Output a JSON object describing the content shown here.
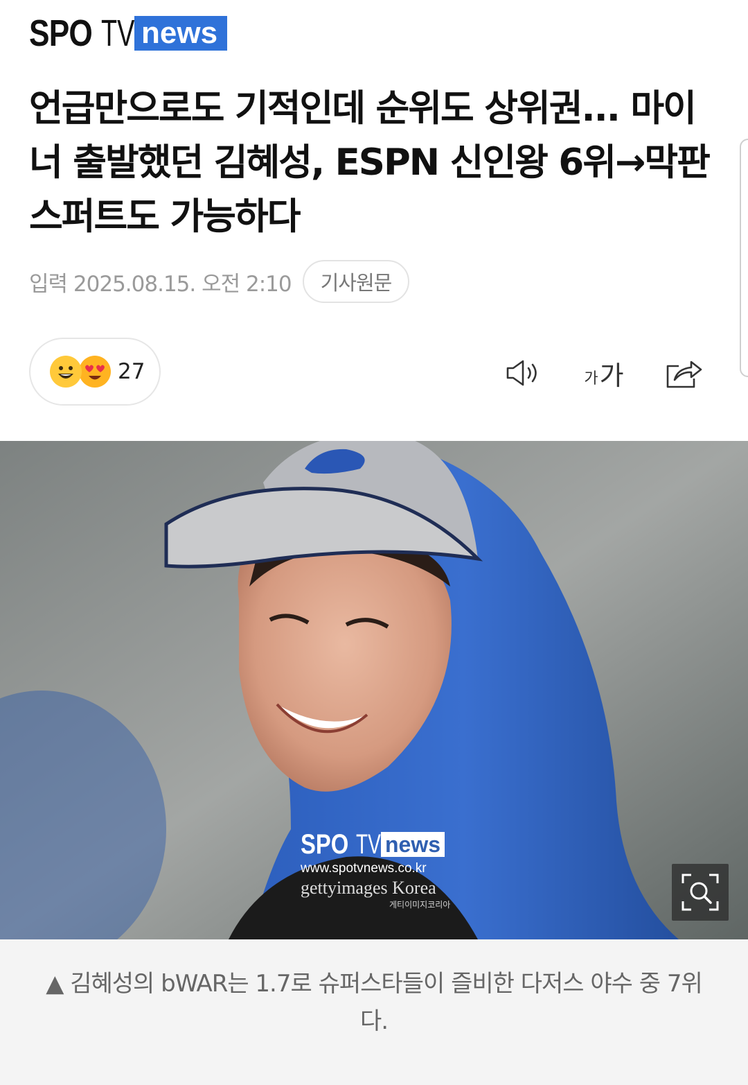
{
  "header": {
    "logo_spo": "SPO",
    "logo_tv": "TV",
    "logo_news": "news"
  },
  "article": {
    "headline": "언급만으로도 기적인데 순위도 상위권... 마이너 출발했던 김혜성, ESPN 신인왕 6위→막판 스퍼트도 가능하다",
    "published": "입력 2025.08.15. 오전 2:10",
    "source_button": "기사원문"
  },
  "reactions": {
    "count": "27",
    "icons": [
      "smile-emoji-icon",
      "heart-eyes-emoji-icon"
    ]
  },
  "toolbar": {
    "speak_icon": "speaker-icon",
    "font_small": "가",
    "font_big": "가",
    "share_icon": "share-icon"
  },
  "photo": {
    "watermark_spo": "SPO",
    "watermark_tv": "TV",
    "watermark_news": "news",
    "watermark_url": "www.spotvnews.co.kr",
    "watermark_getty": "gettyimages Korea",
    "watermark_getty_ko": "게티이미지코리아",
    "zoom_icon": "zoom-search-icon"
  },
  "caption": "▲ 김혜성의 bWAR는 1.7로 슈퍼스타들이 즐비한 다저스 야수 중 7위다.",
  "colors": {
    "brand_blue": "#2f72d9",
    "cap_blue": "#2a57b5",
    "caption_bg": "#f4f4f4"
  }
}
